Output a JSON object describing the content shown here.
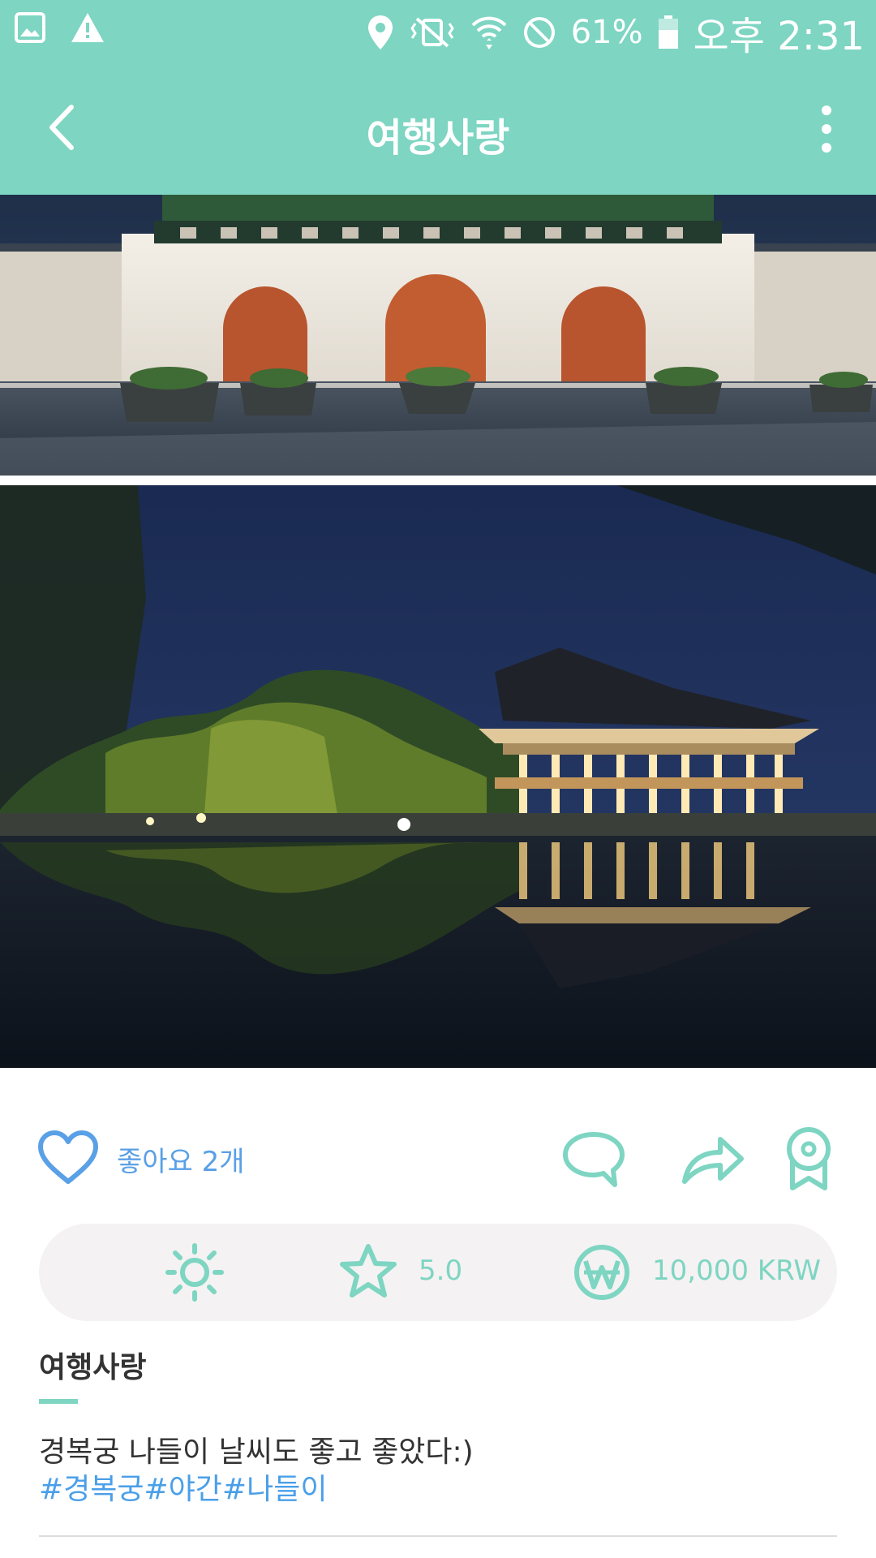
{
  "status_bar": {
    "icons": [
      "image-icon",
      "warning-icon",
      "location-icon",
      "vibrate-off-icon",
      "wifi-icon",
      "do-not-disturb-icon",
      "battery-icon"
    ],
    "battery": "61%",
    "time": "오후 2:31"
  },
  "header": {
    "title": "여행사랑",
    "back_icon": "chevron-left-icon",
    "menu_icon": "more-vert-icon"
  },
  "colors": {
    "accent": "#7dd5c2",
    "like_blue": "#5aa0e6",
    "hashtag_blue": "#4a9fe8"
  },
  "actions": {
    "like_label": "좋아요 2개",
    "icons": [
      "heart-icon",
      "comment-icon",
      "share-icon",
      "badge-icon"
    ]
  },
  "info": {
    "weather_icon": "sun-icon",
    "rating": "5.0",
    "price": "10,000 KRW"
  },
  "post": {
    "author": "여행사랑",
    "text": "경복궁 나들이 날씨도 좋고 좋았다:)",
    "hashtags": "#경복궁#야간#나들이"
  }
}
